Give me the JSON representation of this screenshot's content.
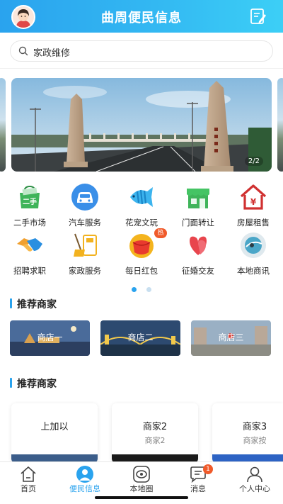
{
  "header": {
    "title": "曲周便民信息"
  },
  "search": {
    "text": "家政维修"
  },
  "banner": {
    "counter": "2/2"
  },
  "categories": [
    {
      "label": "二手市场",
      "icon": "secondhand-market-icon",
      "icon_text": "二手"
    },
    {
      "label": "汽车服务",
      "icon": "car-service-icon"
    },
    {
      "label": "花宠文玩",
      "icon": "pet-fish-icon"
    },
    {
      "label": "门面转让",
      "icon": "storefront-icon"
    },
    {
      "label": "房屋租售",
      "icon": "house-rental-icon",
      "icon_text": "¥"
    },
    {
      "label": "招聘求职",
      "icon": "handshake-icon"
    },
    {
      "label": "家政服务",
      "icon": "housekeeping-icon"
    },
    {
      "label": "每日红包",
      "icon": "red-envelope-icon",
      "badge": "热"
    },
    {
      "label": "征婚交友",
      "icon": "hearts-icon"
    },
    {
      "label": "本地商讯",
      "icon": "local-news-icon"
    }
  ],
  "pager": {
    "pages": 2,
    "active": 0
  },
  "sections": {
    "merchants_1": {
      "title": "推荐商家"
    },
    "merchants_2": {
      "title": "推荐商家"
    }
  },
  "thumbnails": [
    {
      "label": "商店一"
    },
    {
      "label": "商店二"
    },
    {
      "label": "商店三"
    }
  ],
  "cards": [
    {
      "title": "上加以",
      "subtitle": ""
    },
    {
      "title": "商家2",
      "subtitle": "商家2"
    },
    {
      "title": "商家3",
      "subtitle": "商家按"
    }
  ],
  "tabs": [
    {
      "label": "首页",
      "icon": "home-icon"
    },
    {
      "label": "便民信息",
      "icon": "convenience-icon",
      "active": true
    },
    {
      "label": "本地圈",
      "icon": "local-circle-icon"
    },
    {
      "label": "消息",
      "icon": "message-icon",
      "badge": "1"
    },
    {
      "label": "个人中心",
      "icon": "profile-icon"
    }
  ],
  "colors": {
    "accent": "#2aa3ee",
    "badge": "#f05a2a",
    "dot_active": "#2aa3ee",
    "dot_inactive": "#c8dff0"
  }
}
